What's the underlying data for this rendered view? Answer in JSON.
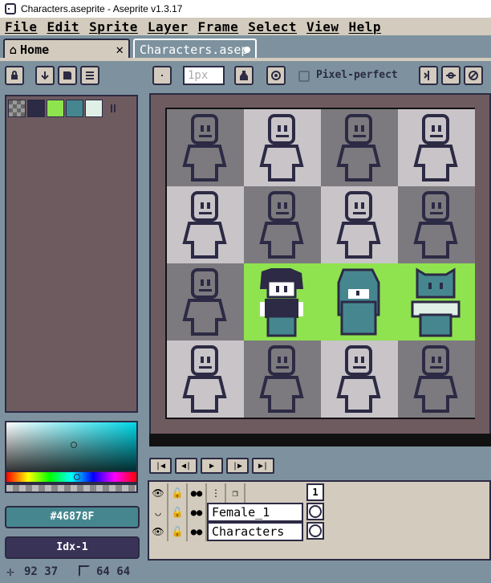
{
  "window": {
    "title": "Characters.aseprite - Aseprite v1.3.17"
  },
  "menu": [
    "File",
    "Edit",
    "Sprite",
    "Layer",
    "Frame",
    "Select",
    "View",
    "Help"
  ],
  "tabs": [
    {
      "label": "Home",
      "icon": "home-icon"
    },
    {
      "label": "Characters.asep",
      "icon": "modified-dot"
    }
  ],
  "toolbar": {
    "brush_size_placeholder": "1px",
    "pixel_perfect_label": "Pixel-perfect"
  },
  "palette": {
    "swatches": [
      "transparent",
      "#2c2a44",
      "#8fe34f",
      "#46878f",
      "#e0f0e6"
    ]
  },
  "color": {
    "hex": "#46878F",
    "index": "Idx-1"
  },
  "timeline": {
    "frame_number": "1",
    "layers": [
      {
        "name": "Female_1",
        "visible": false
      },
      {
        "name": "Characters",
        "visible": true
      }
    ]
  },
  "status": {
    "cursor_position": "92 37",
    "sprite_size": "64 64"
  },
  "colors": {
    "ui_background": "#7d929e",
    "panel_light": "#d3cbbd",
    "outline": "#2c2a44",
    "canvas_bg": "#6e5b60",
    "green": "#8fe34f",
    "teal": "#46878f"
  }
}
